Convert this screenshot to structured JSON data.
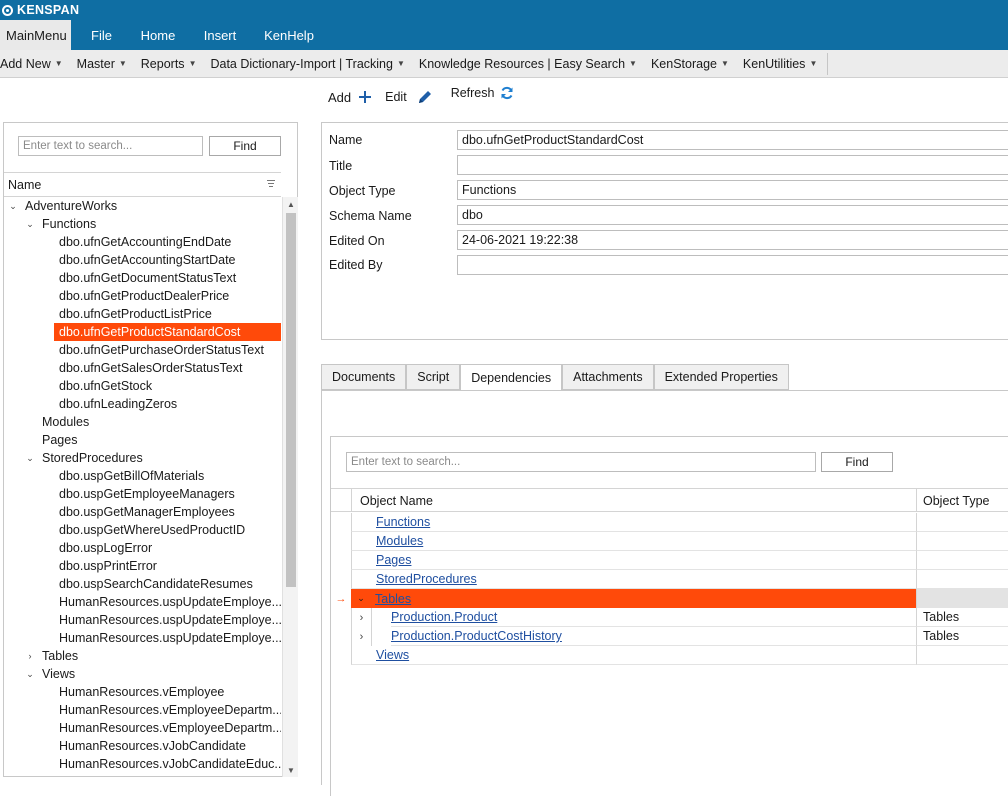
{
  "app": {
    "title": "KENSPAN"
  },
  "ribbon": {
    "tabs": [
      "MainMenu",
      "File",
      "Home",
      "Insert",
      "KenHelp"
    ]
  },
  "menubar": {
    "items": [
      "Add New",
      "Master",
      "Reports",
      "Data Dictionary-Import | Tracking",
      "Knowledge Resources | Easy Search",
      "KenStorage",
      "KenUtilities"
    ]
  },
  "toolbar": {
    "add": "Add",
    "edit": "Edit",
    "refresh": "Refresh"
  },
  "left": {
    "search_placeholder": "Enter text to search...",
    "find": "Find",
    "column": "Name",
    "tree": [
      "AdventureWorks",
      "Functions",
      "dbo.ufnGetAccountingEndDate",
      "dbo.ufnGetAccountingStartDate",
      "dbo.ufnGetDocumentStatusText",
      "dbo.ufnGetProductDealerPrice",
      "dbo.ufnGetProductListPrice",
      "dbo.ufnGetProductStandardCost",
      "dbo.ufnGetPurchaseOrderStatusText",
      "dbo.ufnGetSalesOrderStatusText",
      "dbo.ufnGetStock",
      "dbo.ufnLeadingZeros",
      "Modules",
      "Pages",
      "StoredProcedures",
      "dbo.uspGetBillOfMaterials",
      "dbo.uspGetEmployeeManagers",
      "dbo.uspGetManagerEmployees",
      "dbo.uspGetWhereUsedProductID",
      "dbo.uspLogError",
      "dbo.uspPrintError",
      "dbo.uspSearchCandidateResumes",
      "HumanResources.uspUpdateEmploye...",
      "HumanResources.uspUpdateEmploye...",
      "HumanResources.uspUpdateEmploye...",
      "Tables",
      "Views",
      "HumanResources.vEmployee",
      "HumanResources.vEmployeeDepartm...",
      "HumanResources.vEmployeeDepartm...",
      "HumanResources.vJobCandidate",
      "HumanResources.vJobCandidateEduc..."
    ]
  },
  "details": {
    "labels": [
      "Name",
      "Title",
      "Object Type",
      "Schema Name",
      "Edited On",
      "Edited By"
    ],
    "values": [
      "dbo.ufnGetProductStandardCost",
      "",
      "Functions",
      "dbo",
      "24-06-2021 19:22:38",
      ""
    ]
  },
  "tabs": [
    "Documents",
    "Script",
    "Dependencies",
    "Attachments",
    "Extended Properties"
  ],
  "dependencies": {
    "search_placeholder": "Enter text to search...",
    "find": "Find",
    "columns": [
      "Object Name",
      "Object Type"
    ],
    "rows": [
      {
        "name": "Functions",
        "type": ""
      },
      {
        "name": "Modules",
        "type": ""
      },
      {
        "name": "Pages",
        "type": ""
      },
      {
        "name": "StoredProcedures",
        "type": ""
      },
      {
        "name": "Tables",
        "type": ""
      },
      {
        "name": "Production.Product",
        "type": "Tables"
      },
      {
        "name": "Production.ProductCostHistory",
        "type": "Tables"
      },
      {
        "name": "Views",
        "type": ""
      }
    ]
  },
  "colors": {
    "brand": "#0f6ea3",
    "selection": "#ff4a0a",
    "link": "#1f4fa0"
  }
}
